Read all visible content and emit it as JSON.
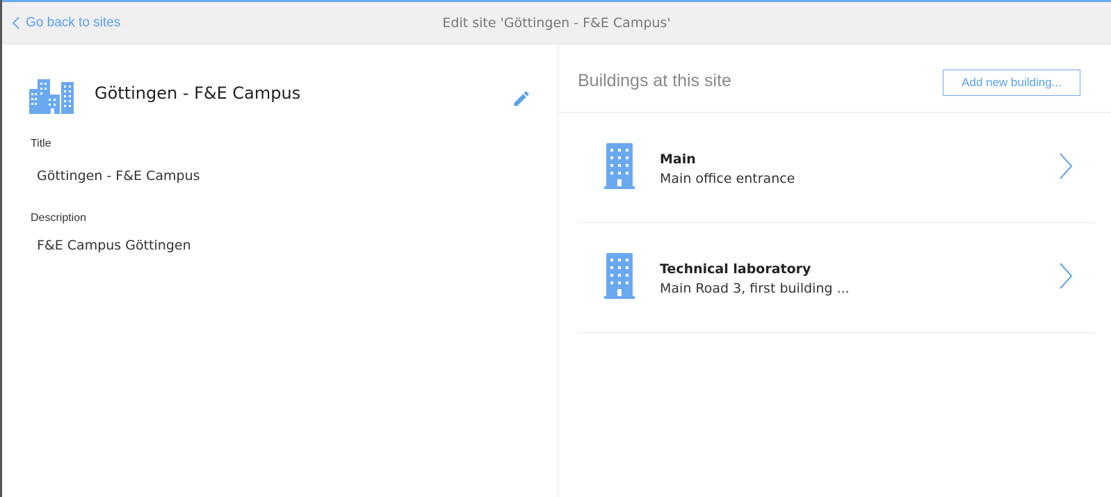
{
  "header": {
    "back_label": "Go back to sites",
    "title": "Edit site 'Göttingen - F&E Campus'"
  },
  "site": {
    "name": "Göttingen - F&E Campus",
    "title_label": "Title",
    "title_value": "Göttingen - F&E Campus",
    "description_label": "Description",
    "description_value": "F&E Campus Göttingen"
  },
  "buildings_panel": {
    "heading": "Buildings at this site",
    "add_button_label": "Add new building...",
    "items": [
      {
        "name": "Main",
        "description": "Main office entrance"
      },
      {
        "name": "Technical laboratory",
        "description": "Main Road 3, first building ..."
      }
    ]
  },
  "colors": {
    "accent": "#6aa9f0",
    "link": "#5aa0ea",
    "topbar_bg": "#f0f0f0"
  },
  "icons": {
    "back": "chevron-left-icon",
    "site": "city-buildings-icon",
    "edit": "pencil-icon",
    "building": "office-building-icon",
    "row_open": "chevron-right-icon"
  }
}
